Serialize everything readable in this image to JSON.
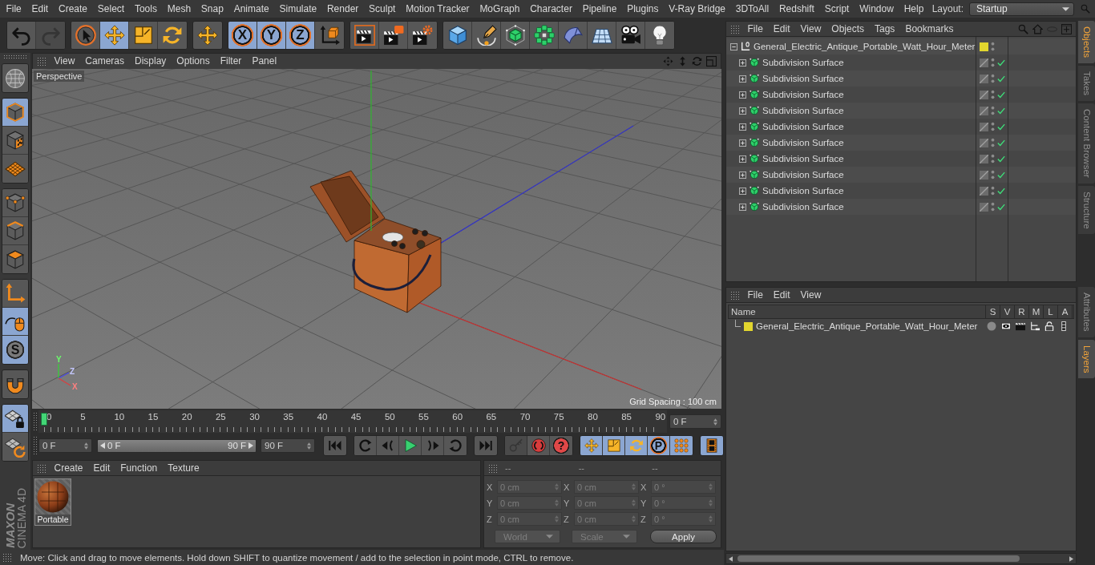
{
  "menu_bar": {
    "items": [
      "File",
      "Edit",
      "Create",
      "Select",
      "Tools",
      "Mesh",
      "Snap",
      "Animate",
      "Simulate",
      "Render",
      "Sculpt",
      "Motion Tracker",
      "MoGraph",
      "Character",
      "Pipeline",
      "Plugins",
      "V-Ray Bridge",
      "3DToAll",
      "Redshift",
      "Script",
      "Window",
      "Help"
    ],
    "layout_label": "Layout:",
    "layout_value": "Startup"
  },
  "toolbar": {
    "groups": [
      [
        {
          "kind": "undo",
          "active": false,
          "disabled": false
        },
        {
          "kind": "redo",
          "active": false,
          "disabled": true
        }
      ],
      [
        {
          "kind": "select",
          "active": false,
          "disabled": false
        },
        {
          "kind": "move",
          "active": true,
          "disabled": false
        },
        {
          "kind": "scale",
          "active": false,
          "disabled": false
        },
        {
          "kind": "rotate",
          "active": false,
          "disabled": false
        }
      ],
      [
        {
          "kind": "recent",
          "active": false,
          "disabled": false
        }
      ],
      [
        {
          "kind": "axis",
          "label": "X",
          "active": true,
          "disabled": false
        },
        {
          "kind": "axis",
          "label": "Y",
          "active": true,
          "disabled": false
        },
        {
          "kind": "axis",
          "label": "Z",
          "active": true,
          "disabled": false
        },
        {
          "kind": "coords",
          "active": false,
          "disabled": false
        }
      ],
      [
        {
          "kind": "renderview",
          "active": false,
          "disabled": false
        },
        {
          "kind": "renderpv",
          "active": false,
          "disabled": false
        },
        {
          "kind": "rendersettings",
          "active": false,
          "disabled": false
        }
      ],
      [
        {
          "kind": "cube",
          "active": false,
          "disabled": false
        },
        {
          "kind": "pen",
          "active": false,
          "disabled": false
        },
        {
          "kind": "subdivision",
          "active": false,
          "disabled": false
        },
        {
          "kind": "cloner",
          "active": false,
          "disabled": false
        },
        {
          "kind": "deformer",
          "active": false,
          "disabled": false
        },
        {
          "kind": "floor",
          "active": false,
          "disabled": false
        },
        {
          "kind": "camera",
          "active": false,
          "disabled": false
        },
        {
          "kind": "light",
          "active": false,
          "disabled": false
        }
      ]
    ]
  },
  "left_toolbar": {
    "groups": [
      [
        {
          "kind": "editable",
          "active": false
        }
      ],
      [
        {
          "kind": "model",
          "active": true
        },
        {
          "kind": "texture",
          "active": false
        },
        {
          "kind": "workplane",
          "active": false
        }
      ],
      [
        {
          "kind": "points",
          "active": false
        },
        {
          "kind": "edges",
          "active": false
        },
        {
          "kind": "polygons",
          "active": false
        }
      ],
      [
        {
          "kind": "axismode",
          "active": false
        },
        {
          "kind": "tweak",
          "active": true
        },
        {
          "kind": "solo",
          "label": "S",
          "active": true
        }
      ],
      [
        {
          "kind": "snap",
          "active": false
        }
      ],
      [
        {
          "kind": "lockworkplane",
          "active": true
        },
        {
          "kind": "planar",
          "active": false
        }
      ]
    ],
    "logo": {
      "brand": "MAXON",
      "product": "CINEMA 4D"
    }
  },
  "viewport": {
    "menu": [
      "View",
      "Cameras",
      "Display",
      "Options",
      "Filter",
      "Panel"
    ],
    "camera": "Perspective",
    "grid_spacing": "Grid Spacing : 100 cm",
    "axis_labels": [
      "Y",
      "Z",
      "X"
    ]
  },
  "timeline": {
    "ticks": [
      "0",
      "5",
      "10",
      "15",
      "20",
      "25",
      "30",
      "35",
      "40",
      "45",
      "50",
      "55",
      "60",
      "65",
      "70",
      "75",
      "80",
      "85",
      "90"
    ],
    "playhead": {
      "level": 0
    },
    "current_frame": "0 F",
    "start_field": "0 F",
    "range": {
      "start": "0 F",
      "end": "90 F",
      "level": 1
    },
    "end_field": "90 F",
    "controls": [
      [
        {
          "kind": "first",
          "active": false,
          "disabled": false
        }
      ],
      [
        {
          "kind": "prevkey",
          "active": false,
          "disabled": false
        },
        {
          "kind": "prevframe",
          "active": false,
          "disabled": false
        },
        {
          "kind": "play",
          "active": false,
          "disabled": false
        },
        {
          "kind": "nextframe",
          "active": false,
          "disabled": false
        },
        {
          "kind": "nextkey",
          "active": false,
          "disabled": false
        }
      ],
      [
        {
          "kind": "last",
          "active": false,
          "disabled": false
        }
      ],
      [
        {
          "kind": "key",
          "active": false,
          "disabled": true
        },
        {
          "kind": "record",
          "active": false,
          "disabled": false
        },
        {
          "kind": "autokey",
          "label": "?",
          "active": false,
          "disabled": false
        }
      ],
      [
        {
          "kind": "keymove",
          "active": true,
          "disabled": false
        },
        {
          "kind": "keyscale",
          "active": true,
          "disabled": false
        },
        {
          "kind": "keyrotate",
          "active": true,
          "disabled": false
        },
        {
          "kind": "param",
          "label": "P",
          "active": true,
          "disabled": false
        },
        {
          "kind": "pla",
          "active": true,
          "disabled": false
        }
      ],
      [
        {
          "kind": "film",
          "active": true,
          "disabled": false
        }
      ]
    ]
  },
  "material_manager": {
    "menu": [
      "Create",
      "Edit",
      "Function",
      "Texture"
    ],
    "materials": [
      {
        "name": "Portable"
      }
    ]
  },
  "coordinates": {
    "headers": [
      "--",
      "--",
      "--"
    ],
    "disabled": true,
    "rows": [
      {
        "axis": "X",
        "position": "0 cm",
        "size_axis": "X",
        "size": "0 cm",
        "rotation_axis": "X",
        "rotation": "0 °"
      },
      {
        "axis": "Y",
        "position": "0 cm",
        "size_axis": "Y",
        "size": "0 cm",
        "rotation_axis": "Y",
        "rotation": "0 °"
      },
      {
        "axis": "Z",
        "position": "0 cm",
        "size_axis": "Z",
        "size": "0 cm",
        "rotation_axis": "Z",
        "rotation": "0 °"
      }
    ],
    "coordinate_mode": "World",
    "size_mode": "Scale",
    "apply": "Apply"
  },
  "status_bar": {
    "text": "Move: Click and drag to move elements. Hold down SHIFT to quantize movement / add to the selection in point mode, CTRL to remove."
  },
  "object_manager": {
    "menu": [
      "File",
      "Edit",
      "View",
      "Objects",
      "Tags",
      "Bookmarks"
    ],
    "objects": [
      {
        "name": "General_Electric_Antique_Portable_Watt_Hour_Meter",
        "kind": "null",
        "expanded": true,
        "color": "#e2d62e",
        "children": [
          {
            "name": "Subdivision Surface",
            "kind": "subdivision",
            "expanded": false,
            "enabled": true
          },
          {
            "name": "Subdivision Surface",
            "kind": "subdivision",
            "expanded": false,
            "enabled": true
          },
          {
            "name": "Subdivision Surface",
            "kind": "subdivision",
            "expanded": false,
            "enabled": true
          },
          {
            "name": "Subdivision Surface",
            "kind": "subdivision",
            "expanded": false,
            "enabled": true
          },
          {
            "name": "Subdivision Surface",
            "kind": "subdivision",
            "expanded": false,
            "enabled": true
          },
          {
            "name": "Subdivision Surface",
            "kind": "subdivision",
            "expanded": false,
            "enabled": true
          },
          {
            "name": "Subdivision Surface",
            "kind": "subdivision",
            "expanded": false,
            "enabled": true
          },
          {
            "name": "Subdivision Surface",
            "kind": "subdivision",
            "expanded": false,
            "enabled": true
          },
          {
            "name": "Subdivision Surface",
            "kind": "subdivision",
            "expanded": false,
            "enabled": true
          },
          {
            "name": "Subdivision Surface",
            "kind": "subdivision",
            "expanded": false,
            "enabled": true
          }
        ]
      }
    ]
  },
  "layer_manager": {
    "menu": [
      "File",
      "Edit",
      "View"
    ],
    "columns": [
      "Name",
      "S",
      "V",
      "R",
      "M",
      "L",
      "A"
    ],
    "layers": [
      {
        "name": "General_Electric_Antique_Portable_Watt_Hour_Meter",
        "color": "#e2d62e"
      }
    ]
  },
  "side_tabs": {
    "upper": [
      {
        "label": "Objects",
        "selected": true
      },
      {
        "label": "Takes",
        "selected": false
      },
      {
        "label": "Content Browser",
        "selected": false
      },
      {
        "label": "Structure",
        "selected": false
      }
    ],
    "lower": [
      {
        "label": "Attributes",
        "selected": false
      },
      {
        "label": "Layers",
        "selected": true
      }
    ]
  }
}
